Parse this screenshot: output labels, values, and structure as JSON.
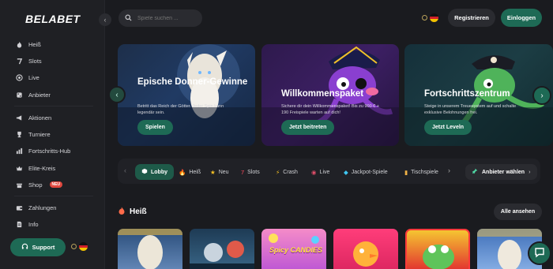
{
  "brand": {
    "logo": "BELABET"
  },
  "sidebar": {
    "items": [
      {
        "label": "Heiß",
        "icon": "flame-icon"
      },
      {
        "label": "Slots",
        "icon": "slot-machine-icon"
      },
      {
        "label": "Live",
        "icon": "casino-chip-icon"
      },
      {
        "label": "Anbieter",
        "icon": "dice-icon"
      },
      {
        "label": "Aktionen",
        "icon": "megaphone-icon"
      },
      {
        "label": "Turniere",
        "icon": "trophy-icon"
      },
      {
        "label": "Fortschritts-Hub",
        "icon": "chart-icon"
      },
      {
        "label": "Elite-Kreis",
        "icon": "crown-icon"
      },
      {
        "label": "Shop",
        "icon": "shop-icon",
        "badge": "NEU"
      },
      {
        "label": "Zahlungen",
        "icon": "wallet-icon"
      },
      {
        "label": "Info",
        "icon": "document-icon"
      }
    ],
    "support_label": "Support"
  },
  "header": {
    "search_placeholder": "Spiele suchen ...",
    "register_label": "Registrieren",
    "login_label": "Einloggen"
  },
  "banners": [
    {
      "title": "Epische Donner-Gewinne",
      "desc": "Betritt das Reich der Götter. Jeder Spin kann legendär sein.",
      "cta": "Spielen"
    },
    {
      "title": "Willkommenspaket",
      "desc": "Sichere dir dein Willkommenspaket! Bis zu 900 € + 190 Freispiele warten auf dich!",
      "cta": "Jetzt beitreten"
    },
    {
      "title": "Fortschrittszentrum",
      "desc": "Steige in unserem Treuesystem auf und schalte exklusive Belohnungen frei.",
      "cta": "Jetzt Leveln"
    }
  ],
  "categories": [
    {
      "label": "Lobby",
      "icon": "cube-icon",
      "active": true
    },
    {
      "label": "Heiß",
      "icon": "flame-icon"
    },
    {
      "label": "Neu",
      "icon": "star-icon"
    },
    {
      "label": "Slots",
      "icon": "slot-machine-icon"
    },
    {
      "label": "Crash",
      "icon": "lightning-icon"
    },
    {
      "label": "Live",
      "icon": "casino-chip-icon"
    },
    {
      "label": "Jackpot-Spiele",
      "icon": "diamond-icon"
    },
    {
      "label": "Tischspiele",
      "icon": "cards-icon"
    }
  ],
  "providers_label": "Anbieter wählen",
  "section": {
    "title": "Heiß",
    "see_all": "Alle ansehen"
  },
  "tiles": [
    {
      "name": "tile-zeus-game",
      "label": ""
    },
    {
      "name": "tile-heist-game",
      "label": ""
    },
    {
      "name": "tile-spicy-candies",
      "label": "Spicy CANDIES"
    },
    {
      "name": "tile-chicken-game",
      "label": ""
    },
    {
      "name": "tile-frog-game",
      "label": ""
    },
    {
      "name": "tile-gates-game",
      "label": ""
    }
  ],
  "colors": {
    "accent": "#1e6a55",
    "bg": "#1a1b1f",
    "sidebar": "#1f2024"
  }
}
